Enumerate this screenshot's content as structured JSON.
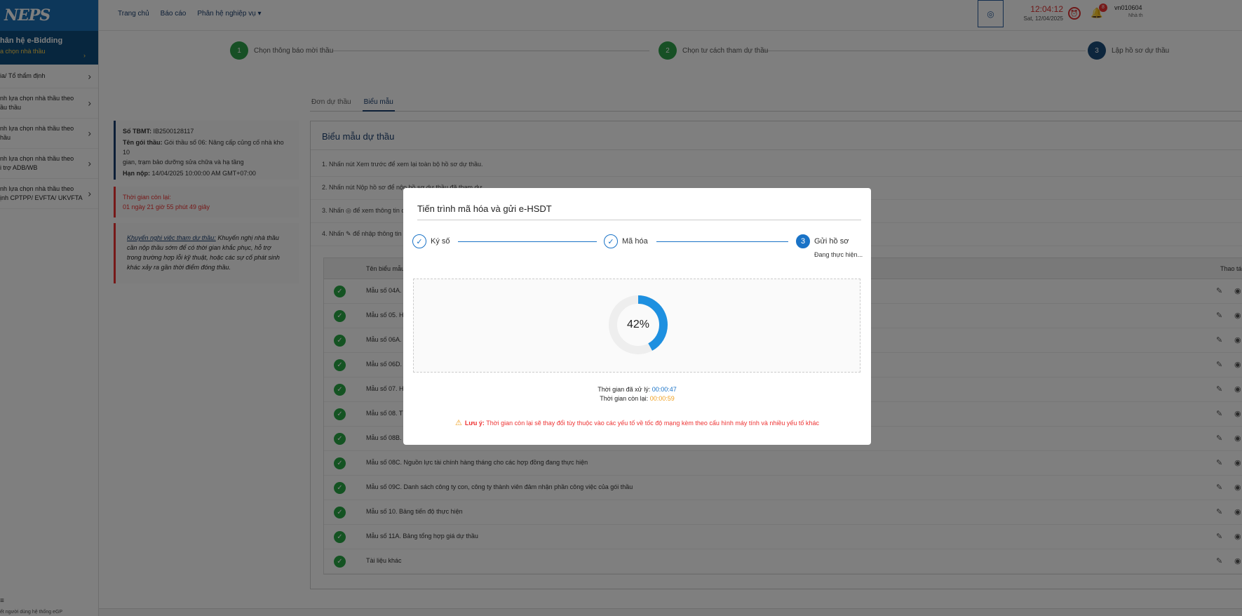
{
  "sidebar": {
    "logo": "NEPS",
    "title": "hân hệ e-Bidding",
    "subtitle": "a chọn nhà thầu",
    "items": [
      {
        "lines": [
          "ia/ Tổ thẩm định"
        ]
      },
      {
        "lines": [
          "nh lựa chọn nhà thầu theo",
          "ầu thầu"
        ]
      },
      {
        "lines": [
          "nh lựa chọn nhà thầu theo",
          "hầu"
        ]
      },
      {
        "lines": [
          "nh lựa chọn nhà thầu theo",
          "i trợ ADB/WB"
        ]
      },
      {
        "lines": [
          "nh lựa chọn nhà thầu theo",
          "ịnh CPTPP/ EVFTA/ UKVFTA"
        ]
      }
    ],
    "footer": "ết người dùng hệ thống eGP"
  },
  "topbar": {
    "nav": [
      "Trang chủ",
      "Báo cáo",
      "Phân hệ nghiệp vụ ▾"
    ],
    "time": "12:04:12",
    "date": "Sat, 12/04/2025",
    "notif_count": "8",
    "user": "vn010604",
    "role": "Nhà th"
  },
  "stepper": [
    {
      "num": "1",
      "label": "Chọn thông báo mời thầu",
      "color": "#2ea04a"
    },
    {
      "num": "2",
      "label": "Chọn tư cách tham dự thầu",
      "color": "#2ea04a"
    },
    {
      "num": "3",
      "label": "Lập hồ sơ dự thầu",
      "color": "#1a4d7a"
    }
  ],
  "tabs": [
    "Đơn dự thầu",
    "Biểu mẫu"
  ],
  "info": {
    "tbmt_label": "Số TBMT:",
    "tbmt": "IB2500128117",
    "pkg_label": "Tên gói thầu:",
    "pkg_line1": "Gói thầu số 06: Nâng cấp củng cố nhà kho 10",
    "pkg_line2": "gian, trạm bảo dưỡng sửa chữa và hạ tầng",
    "deadline_label": "Hạn nộp:",
    "deadline": "14/04/2025 10:00:00 AM GMT+07:00"
  },
  "remaining": {
    "label": "Thời gian còn lại:",
    "value": "01 ngày 21 giờ 55 phút 49 giây"
  },
  "advice": {
    "title": "Khuyến nghị việc tham dự thầu:",
    "l1": "Khuyến nghị nhà thầu",
    "l2": "cần nộp thầu sớm để có thời gian khắc phục, hỗ trợ",
    "l3": "trong trường hợp lỗi kỹ thuật, hoặc các sự cố phát sinh",
    "l4": "khác xảy ra gần thời điểm đóng thầu."
  },
  "panel": {
    "title": "Biểu mẫu dự thầu",
    "instructions": [
      "1. Nhấn nút Xem trước để xem lại toàn bộ hồ sơ dự thầu.",
      "2. Nhấn nút Nộp hồ sơ để nộp hồ sơ dự thầu đã tham dự.",
      "3. Nhấn ◎ để xem thông tin c",
      "4. Nhấn ✎ để nhập thông tin v"
    ],
    "col_name": "Tên biểu mẫu",
    "col_action": "Thao tác",
    "rows": [
      "Mẫu số 04A. E",
      "Mẫu số 05. Họ",
      "Mẫu số 06A. E",
      "Mẫu số 06D. E",
      "Mẫu số 07. Họ",
      "Mẫu số 08. Tì",
      "Mẫu số 08B. C",
      "Mẫu số 08C. Nguồn lực tài chính hàng tháng cho các hợp đồng đang thực hiện",
      "Mẫu số 09C. Danh sách công ty con, công ty thành viên đảm nhận phần công việc của gói thầu",
      "Mẫu số 10. Bảng tiến độ thực hiện",
      "Mẫu số 11A. Bảng tổng hợp giá dự thầu",
      "Tài liệu khác"
    ]
  },
  "modal": {
    "title": "Tiến trình mã hóa và gửi e-HSDT",
    "steps": [
      "Ký số",
      "Mã hóa",
      "Gửi hồ sơ"
    ],
    "step3_num": "3",
    "step3_sub": "Đang thực hiện...",
    "progress_percent": 42,
    "progress_label": "42%",
    "elapsed_label": "Thời gian đã xử lý:",
    "elapsed": "00:00:47",
    "remaining_label": "Thời gian còn lại:",
    "remaining": "00:00:59",
    "note_label": "Lưu ý:",
    "note": "Thời gian còn lại sẽ thay đổi tùy thuộc vào các yếu tố về tốc độ mạng kèm theo cấu hình máy tính và nhiều yếu tố khác"
  }
}
